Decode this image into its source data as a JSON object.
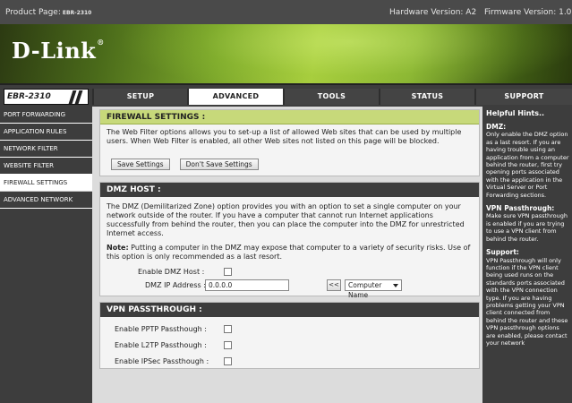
{
  "topbar": {
    "product_label": "Product Page:",
    "product_model": "EBR-2310",
    "hardware": "Hardware Version: A2",
    "firmware": "Firmware Version: 1.05"
  },
  "brand": {
    "logo": "D-Link",
    "registered": "®"
  },
  "nav": {
    "model": "EBR-2310",
    "tabs": [
      {
        "label": "SETUP",
        "active": false
      },
      {
        "label": "ADVANCED",
        "active": true
      },
      {
        "label": "TOOLS",
        "active": false
      },
      {
        "label": "STATUS",
        "active": false
      },
      {
        "label": "SUPPORT",
        "active": false
      }
    ]
  },
  "sidebar": {
    "items": [
      {
        "label": "PORT FORWARDING",
        "active": false
      },
      {
        "label": "APPLICATION RULES",
        "active": false
      },
      {
        "label": "NETWORK FILTER",
        "active": false
      },
      {
        "label": "WEBSITE FILTER",
        "active": false
      },
      {
        "label": "FIREWALL SETTINGS",
        "active": true
      },
      {
        "label": "ADVANCED NETWORK",
        "active": false
      }
    ]
  },
  "firewall": {
    "title": "FIREWALL SETTINGS :",
    "description": "The Web Filter options allows you to set-up a list of allowed Web sites that can be used by multiple users. When Web Filter is enabled, all other Web sites not listed on this page will be blocked.",
    "save_label": "Save Settings",
    "dont_save_label": "Don't Save Settings"
  },
  "dmz": {
    "title": "DMZ HOST :",
    "description": "The DMZ (Demilitarized Zone) option provides you with an option to set a single computer on your network outside of the router. If you have a computer that cannot run Internet applications successfully from behind the router, then you can place the computer into the DMZ for unrestricted Internet access.",
    "note_label": "Note:",
    "note_text": " Putting a computer in the DMZ may expose that computer to a variety of security risks. Use of this option is only recommended as a last resort.",
    "enable_label": "Enable DMZ Host :",
    "enable_checked": false,
    "ip_label": "DMZ IP Address :",
    "ip_value": "0.0.0.0",
    "copy_button": "<<",
    "computer_select": "Computer Name"
  },
  "vpn": {
    "title": "VPN PASSTHROUGH :",
    "pptp_label": "Enable PPTP Passthough :",
    "l2tp_label": "Enable L2TP Passthough :",
    "ipsec_label": "Enable IPSec Passthough :"
  },
  "hints": {
    "title": "Helpful Hints..",
    "dmz_head": "DMZ:",
    "dmz_text": "Only enable the DMZ option as a last resort. If you are having trouble using an application from a computer behind the router, first try opening ports associated with the application in the Virtual Server or Port Forwarding sections.",
    "vpn_head": "VPN Passthrough:",
    "vpn_text": "Make sure VPN passthrough is enabled if you are trying to use a VPN client from behind the router.",
    "support_head": "Support:",
    "support_text": "VPN Passthrough will only function if the VPN client being used runs on the standards ports associated with the VPN connection type. If you are having problems getting your VPN client connected from behind the router and these VPN passthrough options are enabled, please contact your network"
  }
}
